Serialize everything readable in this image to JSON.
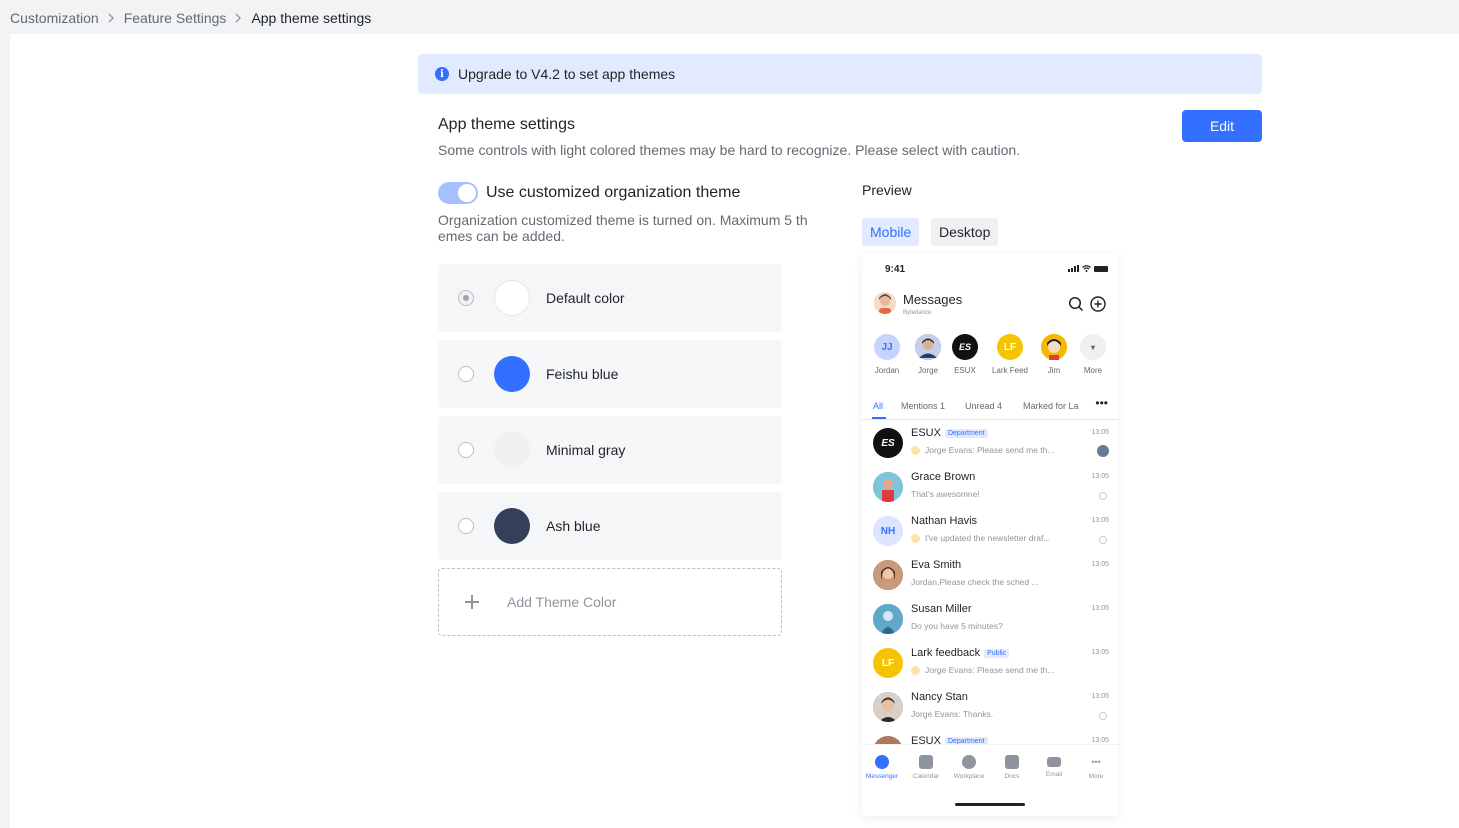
{
  "breadcrumb": {
    "items": [
      "Customization",
      "Feature Settings"
    ],
    "current": "App theme settings"
  },
  "notice": {
    "text": "Upgrade to V4.2 to set app themes"
  },
  "section": {
    "title": "App theme settings",
    "description": "Some controls with light colored themes may be hard to recognize. Please select with caution.",
    "edit_label": "Edit"
  },
  "toggle": {
    "label": "Use customized organization theme",
    "on": true,
    "hint": "Organization customized theme is turned on. Maximum 5 th emes can be added."
  },
  "themes": [
    {
      "name": "Default color",
      "color": "#ffffff",
      "selected": true
    },
    {
      "name": "Feishu blue",
      "color": "#3370ff",
      "selected": false
    },
    {
      "name": "Minimal gray",
      "color": "#eff0f1",
      "selected": false
    },
    {
      "name": "Ash blue",
      "color": "#34405a",
      "selected": false
    }
  ],
  "add_theme": {
    "label": "Add Theme Color"
  },
  "preview": {
    "label": "Preview",
    "tabs": [
      "Mobile",
      "Desktop"
    ],
    "active_tab": "Mobile"
  },
  "phone": {
    "time": "9:41",
    "title": "Messages",
    "subtitle": "Bytedance",
    "stories": [
      {
        "name": "Jordan",
        "initials": "JJ",
        "bg": "#c5d4ff",
        "fg": "#3370ff"
      },
      {
        "name": "Jorge",
        "initials": "",
        "bg": "#3d4a7a",
        "fg": "#ffffff"
      },
      {
        "name": "ESUX",
        "initials": "ES",
        "bg": "#111111",
        "fg": "#ffffff"
      },
      {
        "name": "Lark Feed",
        "initials": "LF",
        "bg": "#f5c400",
        "fg": "#ffffff"
      },
      {
        "name": "Jim",
        "initials": "",
        "bg": "#f5b800",
        "fg": "#ffffff"
      },
      {
        "name": "More",
        "initials": "▾",
        "bg": "#eff0f1",
        "fg": "#646a73"
      }
    ],
    "tabs": [
      "All",
      "Mentions 1",
      "Unread 4",
      "Marked for La"
    ],
    "chats": [
      {
        "name": "ESUX",
        "tag": "Department",
        "message": "Jorge Evans: Please send me th...",
        "time": "13:05",
        "initials": "ES",
        "bg": "#111111",
        "fg": "#ffffff",
        "mini": true,
        "status": "avatar"
      },
      {
        "name": "Grace Brown",
        "tag": "",
        "message": "That's awesomne!",
        "time": "13:05",
        "initials": "",
        "bg": "#7fc4d8",
        "fg": "#ffffff",
        "mini": false,
        "status": "ring"
      },
      {
        "name": "Nathan Havis",
        "tag": "",
        "message": "I've updated the newsletter draf...",
        "time": "13:05",
        "initials": "NH",
        "bg": "#dbe5ff",
        "fg": "#3370ff",
        "mini": true,
        "status": "ring"
      },
      {
        "name": "Eva Smith",
        "tag": "",
        "message": "Jordan,Please check the sched ...",
        "time": "13:05",
        "initials": "",
        "bg": "#b07a5a",
        "fg": "#ffffff",
        "mini": false,
        "status": "none"
      },
      {
        "name": "Susan Miller",
        "tag": "",
        "message": "Do you have 5 minutes?",
        "time": "13:05",
        "initials": "",
        "bg": "#4a8fb0",
        "fg": "#ffffff",
        "mini": false,
        "status": "none"
      },
      {
        "name": "Lark feedback",
        "tag": "Public",
        "message": "Jorge Evans: Please send me th...",
        "time": "13:05",
        "initials": "LF",
        "bg": "#f5c400",
        "fg": "#ffffff",
        "mini": true,
        "status": "none"
      },
      {
        "name": "Nancy Stan",
        "tag": "",
        "message": "Jorge Evans: Thanks.",
        "time": "13:05",
        "initials": "",
        "bg": "#8a7b70",
        "fg": "#ffffff",
        "mini": false,
        "status": "ring"
      },
      {
        "name": "ESUX",
        "tag": "Department",
        "message": "",
        "time": "13:05",
        "initials": "",
        "bg": "#b07a5a",
        "fg": "#ffffff",
        "mini": false,
        "status": "none"
      }
    ],
    "nav": [
      {
        "label": "Messenger",
        "active": true
      },
      {
        "label": "Calendar",
        "active": false
      },
      {
        "label": "Workplace",
        "active": false
      },
      {
        "label": "Docs",
        "active": false
      },
      {
        "label": "Email",
        "active": false
      },
      {
        "label": "More",
        "active": false
      }
    ]
  }
}
